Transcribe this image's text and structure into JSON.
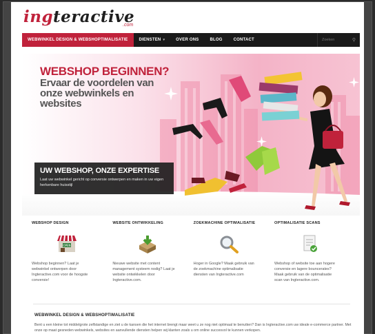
{
  "logo": {
    "brand_a": "ing",
    "brand_b": "teractive",
    "suffix": ".com"
  },
  "nav": {
    "items": [
      {
        "label": "WEBWINKEL DESIGN & WEBSHOPTIMALISATIE",
        "active": true
      },
      {
        "label": "DIENSTEN",
        "caret": "▾"
      },
      {
        "label": "OVER ONS"
      },
      {
        "label": "BLOG"
      },
      {
        "label": "CONTACT"
      }
    ],
    "search_placeholder": "Zoeken",
    "search_icon": "search-icon"
  },
  "hero": {
    "title": "WEBSHOP BEGINNEN?",
    "subtitle": "Ervaar de voordelen van onze webwinkels en websites",
    "box_title": "UW WEBSHOP, ONZE EXPERTISE",
    "box_text": "Laat uw webwinkel gericht op conversie ontwerpen en maken in uw eigen herkenbare huisstijl"
  },
  "services": [
    {
      "title": "WEBSHOP DESIGN",
      "icon": "shop-icon",
      "text": "Webshop beginnen? Laat je webwinkel ontwerpen door Ingteractive.com voor de hoogste conversie!"
    },
    {
      "title": "WEBSITE ONTWIKKELING",
      "icon": "download-box-icon",
      "text": "Nieuwe website met content management systeem nodig? Laat je website ontwikkelen door Ingteractive.com."
    },
    {
      "title": "ZOEKMACHINE OPTIMALISATIE",
      "icon": "magnifier-icon",
      "text": "Hoger in Google? Maak gebruik van de zoekmachine optimalisatie diensten van Ingteractive.com"
    },
    {
      "title": "OPTIMALISATIE SCANS",
      "icon": "document-check-icon",
      "text": "Webshop of website toe aan hogere conversie en lagere bouncerates? Maak gebruik van de optimalisatie scan van Ingteractive.com."
    }
  ],
  "section": {
    "title": "WEBWINKEL DESIGN & WEBSHOPTIMALISATIE",
    "text": "Bent u een kleine tot middelgrote zelfstandige en ziet u de kansen die het internet brengt maar weet u ze nog niet optimaal te benutten? Dan is Ingteractive.com uw ideale e-commerce partner. Met onze op maat gesneden webwinkels, websites en aanvullende diensten helpen wij klanten zoals u om online succesvol te kunnen verkopen."
  },
  "colors": {
    "accent": "#c0223b",
    "nav_bg": "#1a1a1a",
    "hero_pink": "#f3a7bd"
  }
}
